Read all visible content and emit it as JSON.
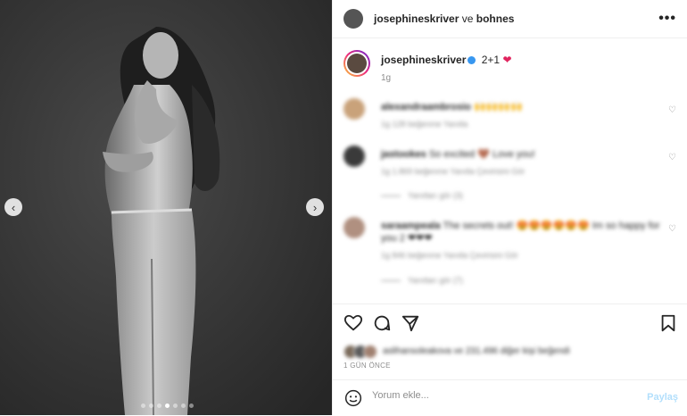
{
  "post": {
    "header": {
      "username": "josephineskriver",
      "connector": "ve",
      "collaborator": "bohnes",
      "more_icon": "more-horizontal-icon"
    },
    "photo": {
      "prev_icon": "chevron-left-icon",
      "next_icon": "chevron-right-icon",
      "slide_count": 7,
      "active_slide": 4
    },
    "caption": {
      "username": "josephineskriver",
      "text": "2+1",
      "emoji": "❤",
      "time": "1g"
    },
    "comments": [
      {
        "user": "alexandraambrosio",
        "text": "🙌🙌🙌🙌",
        "likes": "1g   128 beğenme   Yanıtla",
        "replies": ""
      },
      {
        "user": "jastookes",
        "text": "So excited 🤎 Love you!",
        "likes": "1g   1.869 beğenme   Yanıtla   Çevirisini Gör",
        "replies": "Yanıtları gör (3)"
      },
      {
        "user": "saraampeala",
        "text": "The secrets out! 😍😍😍😍😍😍 Im so happy for you 2 ❤❤❤",
        "likes": "1g   846 beğenme   Yanıtla   Çevirisini Gör",
        "replies": "Yanıtları gör (7)"
      }
    ],
    "actions": {
      "like_icon": "heart-icon",
      "comment_icon": "comment-icon",
      "share_icon": "share-icon",
      "save_icon": "bookmark-icon"
    },
    "likes_text": "aslihansoleakova ve 231.496 diğer kişi beğendi",
    "time_ago": "1 GÜN ÖNCE",
    "comment_input": {
      "emoji_icon": "smiley-icon",
      "placeholder": "Yorum ekle...",
      "post_label": "Paylaş"
    },
    "colors": {
      "accent": "#3897f0",
      "post_disabled": "#b2dffc",
      "heart": "#e0245e"
    }
  }
}
